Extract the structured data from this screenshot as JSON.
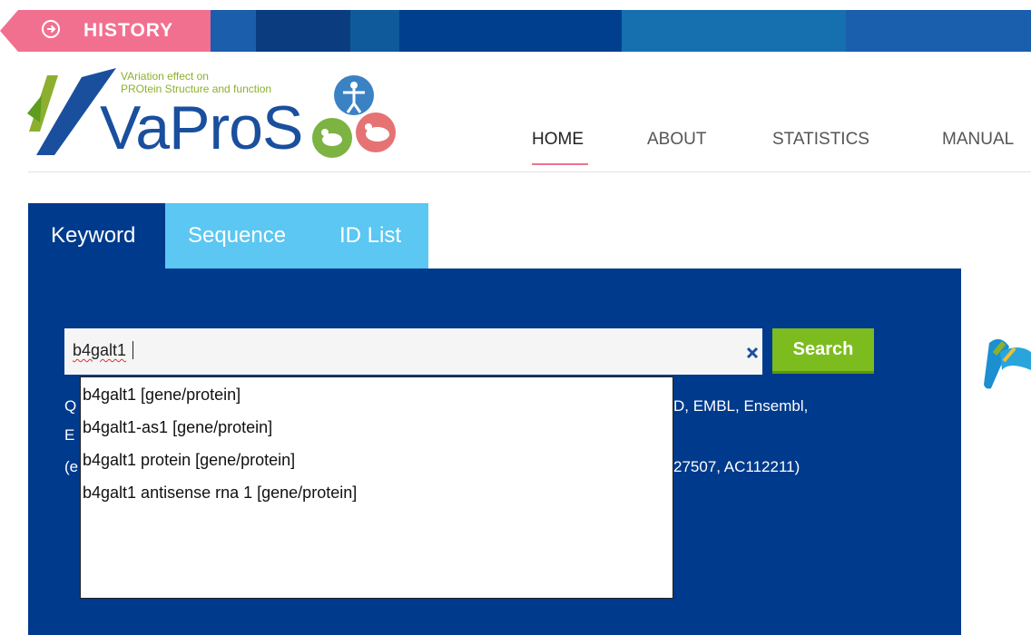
{
  "history": {
    "label": "HISTORY",
    "icon": "arrow-right-circle-icon",
    "bg": "#f2708f"
  },
  "logo": {
    "tagline_line1": "VAriation effect on",
    "tagline_line2": "PROtein Structure and function",
    "name": "VaProS"
  },
  "nav": {
    "items": [
      {
        "label": "HOME",
        "active": true
      },
      {
        "label": "ABOUT"
      },
      {
        "label": "STATISTICS"
      },
      {
        "label": "MANUAL"
      }
    ]
  },
  "tabs": [
    {
      "label": "Keyword",
      "active": true
    },
    {
      "label": "Sequence"
    },
    {
      "label": "ID List"
    }
  ],
  "search": {
    "value": "b4galt1",
    "button_label": "Search",
    "clear_icon": "close-icon",
    "accent": "#7cbc1e"
  },
  "help": {
    "line1_visible_left": "Q",
    "line1_visible_right": "D, EMBL, Ensembl,",
    "line2_visible_left": "E",
    "line3_visible_left": "(e",
    "line3_visible_right": "27507, AC112211)"
  },
  "suggestions": [
    "b4galt1 [gene/protein]",
    "b4galt1-as1 [gene/protein]",
    "b4galt1 protein [gene/protein]",
    "b4galt1 antisense rna 1 [gene/protein]"
  ],
  "colors": {
    "panel": "#003a8c",
    "tab_inactive": "#5bc7f2",
    "brand_blue": "#1a4f9e",
    "pink": "#f2708f"
  }
}
